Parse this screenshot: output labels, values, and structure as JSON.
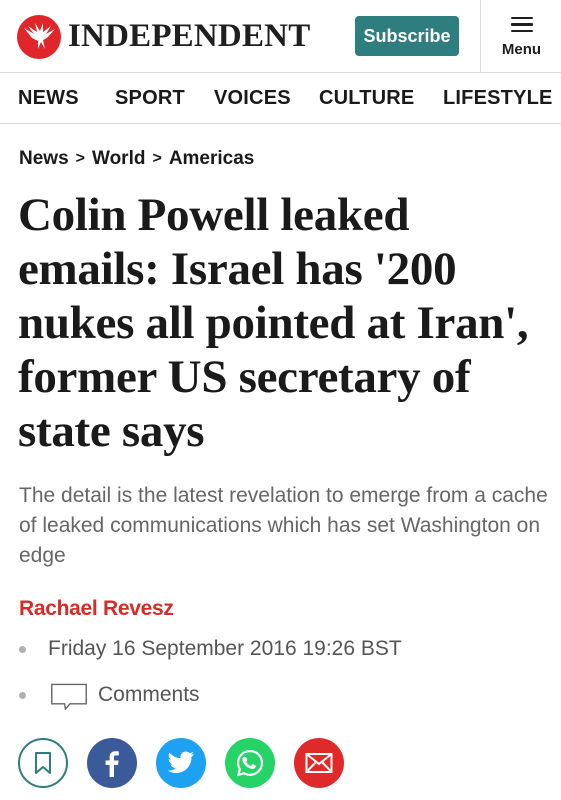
{
  "header": {
    "logo_text": "INDEPENDENT",
    "subscribe_label": "Subscribe",
    "menu_label": "Menu"
  },
  "nav": {
    "items": [
      "NEWS",
      "SPORT",
      "VOICES",
      "CULTURE",
      "LIFESTYLE"
    ]
  },
  "breadcrumb": {
    "items": [
      "News",
      "World",
      "Americas"
    ],
    "separator": ">"
  },
  "article": {
    "headline": "Colin Powell leaked emails: Israel has '200 nukes all pointed at Iran', former US secretary of state says",
    "standfirst": "The detail is the latest revelation to emerge from a cache of leaked communications which has set Washington on edge",
    "author": "Rachael Revesz",
    "date": "Friday 16 September 2016 19:26 BST",
    "comments_label": "Comments"
  },
  "share": {
    "buttons": [
      "bookmark-icon",
      "facebook-icon",
      "twitter-icon",
      "whatsapp-icon",
      "email-icon"
    ]
  },
  "colors": {
    "brand_red": "#e0262b",
    "subscribe": "#2e7d7f",
    "author_red": "#d82a27",
    "facebook": "#3b5a9a",
    "twitter": "#1da1f2",
    "whatsapp": "#25d366",
    "email": "#e02a2a",
    "bookmark": "#2e7d7f"
  }
}
